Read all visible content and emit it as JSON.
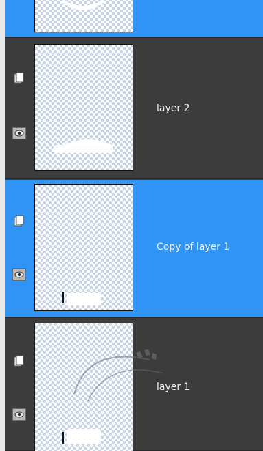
{
  "layers": [
    {
      "id": "layer-top",
      "label": "",
      "selected": true
    },
    {
      "id": "layer-2",
      "label": "layer 2",
      "selected": false
    },
    {
      "id": "copy-of-layer-1",
      "label": "Copy of layer 1",
      "selected": true
    },
    {
      "id": "layer-1",
      "label": "layer 1",
      "selected": false
    }
  ],
  "icons": {
    "mask": "layer-mask-icon",
    "visibility": "eye-icon"
  },
  "colors": {
    "selected_bg": "#2f94f4",
    "panel_bg": "#3c3c3c",
    "checker": "#c5d3e4"
  }
}
